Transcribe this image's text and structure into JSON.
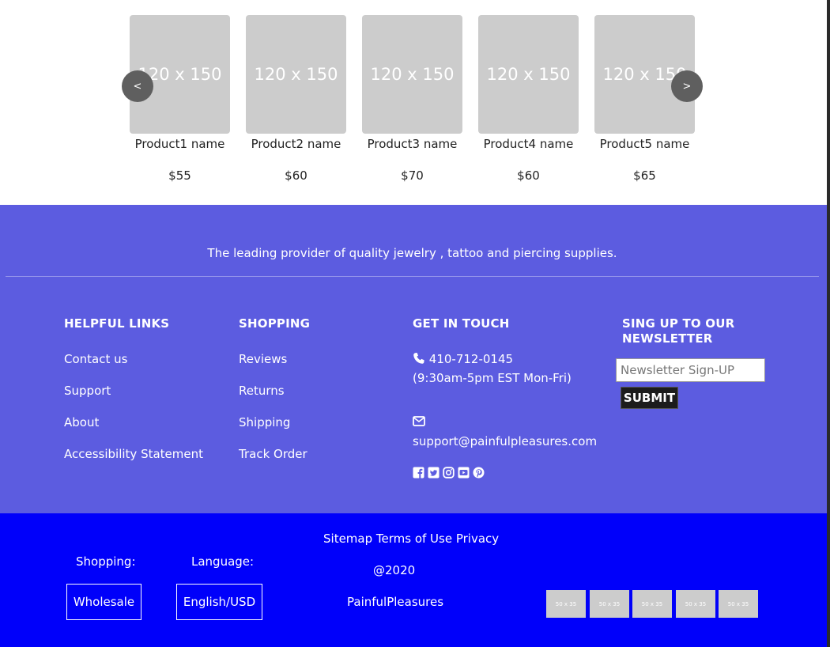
{
  "carousel": {
    "prev_label": "<",
    "next_label": ">",
    "products": [
      {
        "thumb": "120 x 150",
        "name": "Product1 name",
        "price": "$55"
      },
      {
        "thumb": "120 x 150",
        "name": "Product2 name",
        "price": "$60"
      },
      {
        "thumb": "120 x 150",
        "name": "Product3 name",
        "price": "$70"
      },
      {
        "thumb": "120 x 150",
        "name": "Product4 name",
        "price": "$60"
      },
      {
        "thumb": "120 x 150",
        "name": "Product5 name",
        "price": "$65"
      }
    ]
  },
  "footer": {
    "tagline": "The leading provider of quality jewelry , tattoo and piercing supplies.",
    "helpful_links": {
      "title": "HELPFUL LINKS",
      "items": [
        "Contact us",
        "Support",
        "About",
        "Accessibility Statement"
      ]
    },
    "shopping": {
      "title": "SHOPPING",
      "items": [
        "Reviews",
        "Returns",
        "Shipping",
        "Track Order"
      ]
    },
    "contact": {
      "title": "GET IN TOUCH",
      "phone": "410-712-0145",
      "hours": "(9:30am-5pm EST Mon-Fri)",
      "email": "support@painfulpleasures.com",
      "icons": [
        "phone-icon",
        "envelope-icon"
      ],
      "social_icons": [
        "facebook-icon",
        "twitter-icon",
        "instagram-icon",
        "youtube-icon",
        "pinterest-icon"
      ]
    },
    "newsletter": {
      "title_line1": "SING UP TO OUR",
      "title_line2": "NEWSLETTER",
      "placeholder": "Newsletter Sign-UP",
      "submit_label": "SUBMIT"
    }
  },
  "bottom": {
    "links": "Sitemap Terms of Use Privacy",
    "copyright": "@2020",
    "brand": "PainfulPleasures",
    "shopping_label": "Shopping:",
    "shopping_value": "Wholesale",
    "language_label": "Language:",
    "language_value": "English/USD",
    "payment_images": [
      "50 x 35",
      "50 x 35",
      "50 x 35",
      "50 x 35",
      "50 x 35"
    ]
  },
  "colors": {
    "footer_top": "#5c5ce0",
    "footer_bottom": "#0000fa",
    "placeholder_gray": "#cccccc"
  }
}
